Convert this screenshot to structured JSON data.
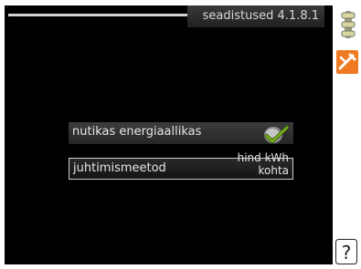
{
  "header": {
    "title": "seadistused 4.1.8.1"
  },
  "settings": [
    {
      "label": "nutikas energiaallikas",
      "state": "checked"
    },
    {
      "label": "juhtimismeetod",
      "value_line1": "hind kWh",
      "value_line2": "kohta"
    }
  ],
  "sidebar": {
    "icons": [
      "slider-icon",
      "tools-icon",
      "help-icon"
    ]
  },
  "colors": {
    "screen_bg": "#000000",
    "text": "#e6e6e6",
    "check_green": "#7fbf1f",
    "tools_orange": "#f07a22"
  }
}
